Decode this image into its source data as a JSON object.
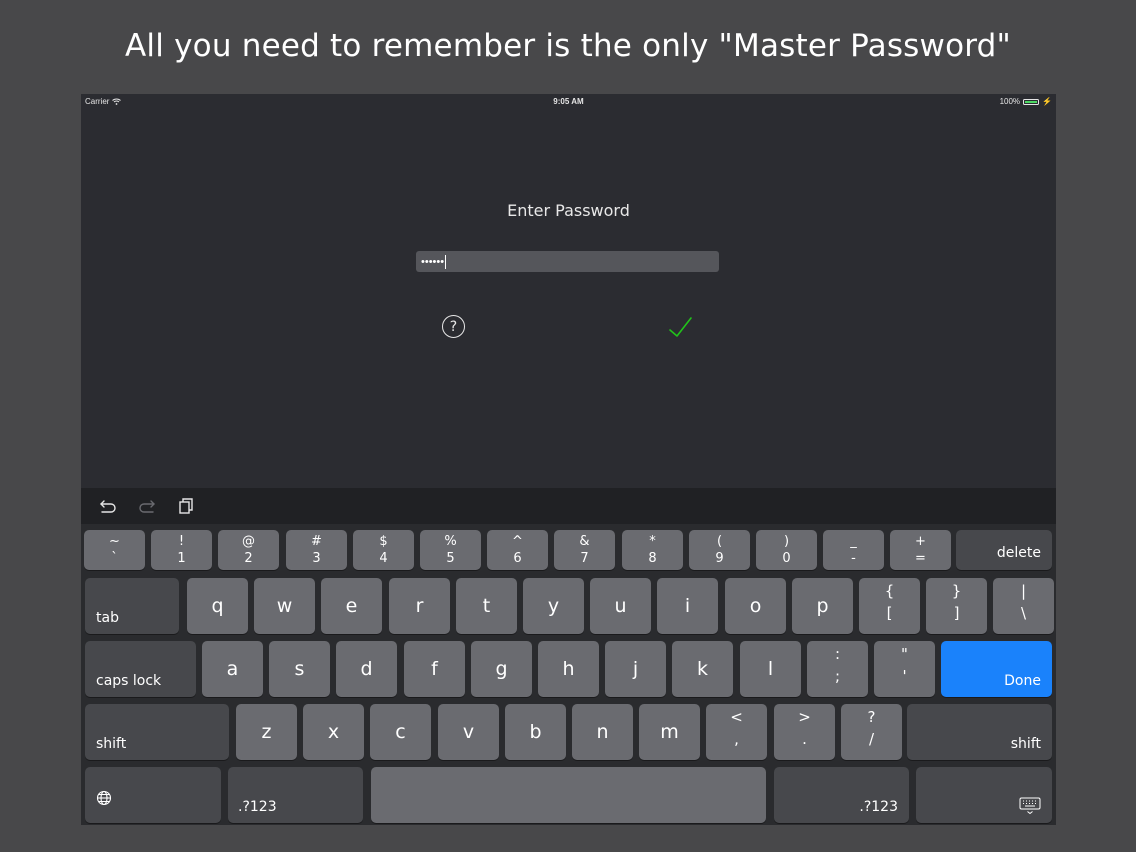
{
  "caption": "All you need to remember is the only \"Master Password\"",
  "status_bar": {
    "carrier": "Carrier",
    "time": "9:05 AM",
    "battery": "100%",
    "battery_color": "#4cd964"
  },
  "prompt": {
    "title": "Enter Password",
    "password_mask": "••••••",
    "help_label": "?",
    "help_icon": "question-circle-icon",
    "confirm_icon": "checkmark-icon",
    "confirm_color": "#21c21a"
  },
  "toolbar": {
    "undo_icon": "undo-icon",
    "redo_icon": "redo-icon",
    "paste_icon": "paste-icon"
  },
  "keyboard": {
    "number_row": [
      {
        "top": "~",
        "bottom": "`"
      },
      {
        "top": "!",
        "bottom": "1"
      },
      {
        "top": "@",
        "bottom": "2"
      },
      {
        "top": "#",
        "bottom": "3"
      },
      {
        "top": "$",
        "bottom": "4"
      },
      {
        "top": "%",
        "bottom": "5"
      },
      {
        "top": "^",
        "bottom": "6"
      },
      {
        "top": "&",
        "bottom": "7"
      },
      {
        "top": "*",
        "bottom": "8"
      },
      {
        "top": "(",
        "bottom": "9"
      },
      {
        "top": ")",
        "bottom": "0"
      },
      {
        "top": "_",
        "bottom": "-"
      },
      {
        "top": "+",
        "bottom": "="
      }
    ],
    "delete_label": "delete",
    "tab_label": "tab",
    "row_q": [
      "q",
      "w",
      "e",
      "r",
      "t",
      "y",
      "u",
      "i",
      "o",
      "p"
    ],
    "row_q_symbols": [
      {
        "top": "{",
        "bottom": "["
      },
      {
        "top": "}",
        "bottom": "]"
      },
      {
        "top": "|",
        "bottom": "\\"
      }
    ],
    "caps_label": "caps lock",
    "row_a": [
      "a",
      "s",
      "d",
      "f",
      "g",
      "h",
      "j",
      "k",
      "l"
    ],
    "row_a_symbols": [
      {
        "top": ":",
        "bottom": ";"
      },
      {
        "top": "\"",
        "bottom": "'"
      }
    ],
    "done_label": "Done",
    "done_color": "#1a82fb",
    "shift_label": "shift",
    "row_z": [
      "z",
      "x",
      "c",
      "v",
      "b",
      "n",
      "m"
    ],
    "row_z_symbols": [
      {
        "top": "<",
        "bottom": ","
      },
      {
        "top": ">",
        "bottom": "."
      },
      {
        "top": "?",
        "bottom": "/"
      }
    ],
    "numbers_label": ".?123",
    "globe_icon": "globe-icon",
    "dismiss_icon": "keyboard-dismiss-icon"
  }
}
